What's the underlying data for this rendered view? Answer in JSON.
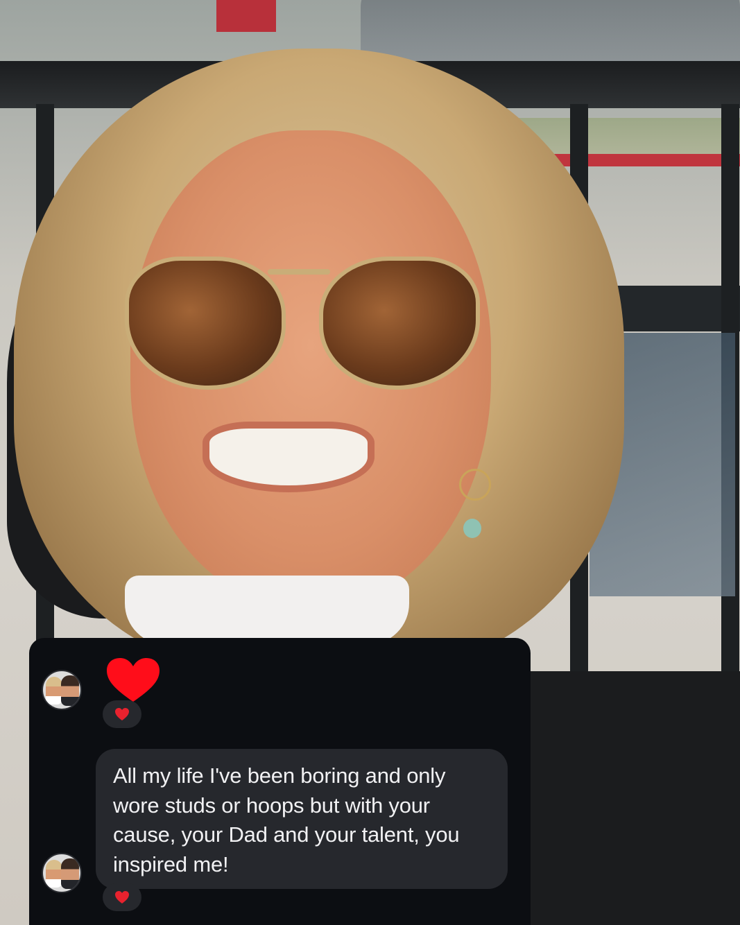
{
  "message": {
    "text": "All my life I've been boring and only wore studs or hoops but with your cause, your Dad and your talent, you inspired me!"
  },
  "reactions": {
    "heart_emoji": "❤️",
    "big_heart_color": "#ff0d1a",
    "reaction_heart_color": "#e8222e"
  },
  "colors": {
    "card_bg": "#0c0e12",
    "bubble_bg": "#26282d",
    "text": "#f1f1f3"
  }
}
